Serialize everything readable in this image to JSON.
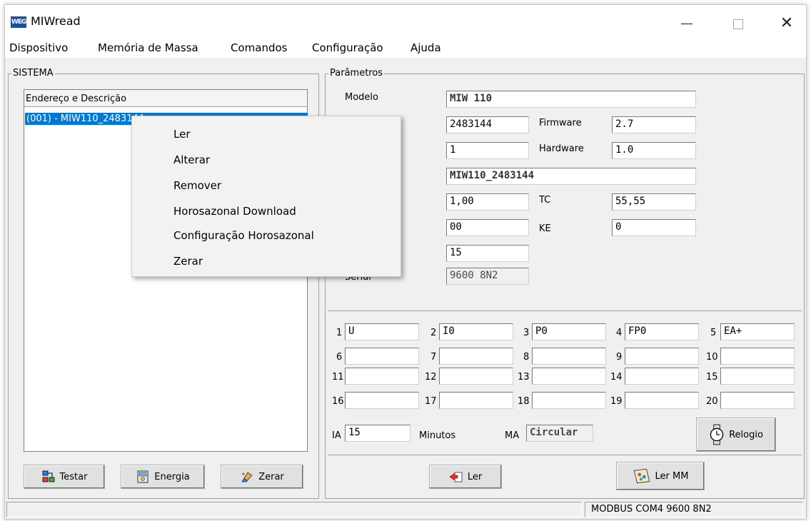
{
  "window": {
    "title": "MIWread",
    "icon_text": "WEG"
  },
  "menubar": [
    "Dispositivo",
    "Memória de Massa",
    "Comandos",
    "Configuração",
    "Ajuda"
  ],
  "sistema": {
    "legend": "SISTEMA",
    "list_header": "Endereço e Descrição",
    "selected_item": "(001) - MIW110_2483144",
    "buttons": {
      "testar": "Testar",
      "energia": "Energia",
      "zerar": "Zerar"
    }
  },
  "parametros": {
    "legend": "Parâmetros",
    "labels": {
      "modelo": "Modelo",
      "firmware": "Firmware",
      "hardware": "Hardware",
      "tc": "TC",
      "ke": "KE",
      "serial": "Serial"
    },
    "values": {
      "modelo": "MIW 110",
      "serie": "2483144",
      "firmware": "2.7",
      "endereco": "1",
      "hardware": "1.0",
      "descricao": "MIW110_2483144",
      "tp": "1,00",
      "tc": "55,55",
      "fe": "00",
      "ke": "0",
      "ip": "15",
      "serial": "9600 8N2"
    }
  },
  "channels": [
    {
      "n": "1",
      "v": "U"
    },
    {
      "n": "2",
      "v": "I0"
    },
    {
      "n": "3",
      "v": "P0"
    },
    {
      "n": "4",
      "v": "FP0"
    },
    {
      "n": "5",
      "v": "EA+"
    },
    {
      "n": "6",
      "v": ""
    },
    {
      "n": "7",
      "v": ""
    },
    {
      "n": "8",
      "v": ""
    },
    {
      "n": "9",
      "v": ""
    },
    {
      "n": "10",
      "v": ""
    },
    {
      "n": "11",
      "v": ""
    },
    {
      "n": "12",
      "v": ""
    },
    {
      "n": "13",
      "v": ""
    },
    {
      "n": "14",
      "v": ""
    },
    {
      "n": "15",
      "v": ""
    },
    {
      "n": "16",
      "v": ""
    },
    {
      "n": "17",
      "v": ""
    },
    {
      "n": "18",
      "v": ""
    },
    {
      "n": "19",
      "v": ""
    },
    {
      "n": "20",
      "v": ""
    }
  ],
  "integration": {
    "ia_label": "IA",
    "ia_value": "15",
    "minutos": "Minutos",
    "ma_label": "MA",
    "ma_value": "Circular",
    "relogio": "Relogio"
  },
  "actions": {
    "ler": "Ler",
    "ler_mm": "Ler MM"
  },
  "status": {
    "connection": "MODBUS COM4 9600 8N2"
  },
  "context_menu": [
    "Ler",
    "Alterar",
    "Remover",
    "Horosazonal Download",
    "Configuração Horosazonal",
    "Zerar"
  ]
}
